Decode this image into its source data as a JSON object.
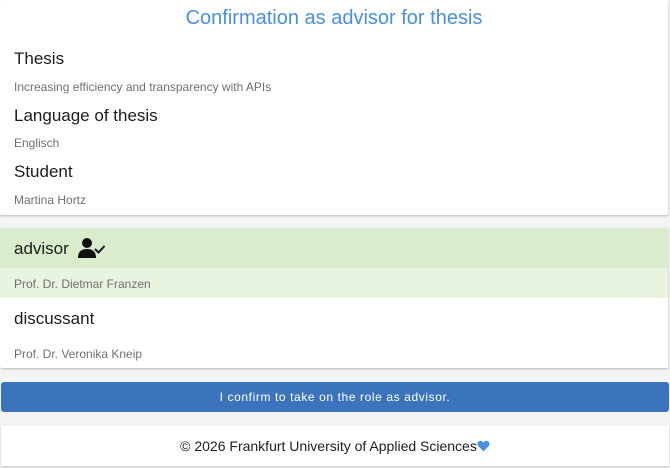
{
  "header": {
    "title": "Confirmation as advisor for thesis"
  },
  "thesis": {
    "label": "Thesis",
    "value": "Increasing efficiency and transparency with APIs"
  },
  "language": {
    "label": "Language of thesis",
    "value": "Englisch"
  },
  "student": {
    "label": "Student",
    "value": "Martina Hortz"
  },
  "roles": {
    "advisor": {
      "label": "advisor",
      "value": "Prof. Dr. Dietmar Franzen",
      "icon": "user-check-icon"
    },
    "discussant": {
      "label": "discussant",
      "value": "Prof. Dr. Veronika Kneip"
    }
  },
  "actions": {
    "confirm_label": "I confirm to take on the role as advisor."
  },
  "footer": {
    "text": "© 2026 Frankfurt University of Applied Sciences",
    "icon": "heart-icon"
  },
  "colors": {
    "title": "#4a90e2",
    "advisor_highlight": "#d9edcc",
    "advisor_value_bg": "#e8f4e0",
    "button": "#3b74bd",
    "heart": "#4a90e2"
  }
}
